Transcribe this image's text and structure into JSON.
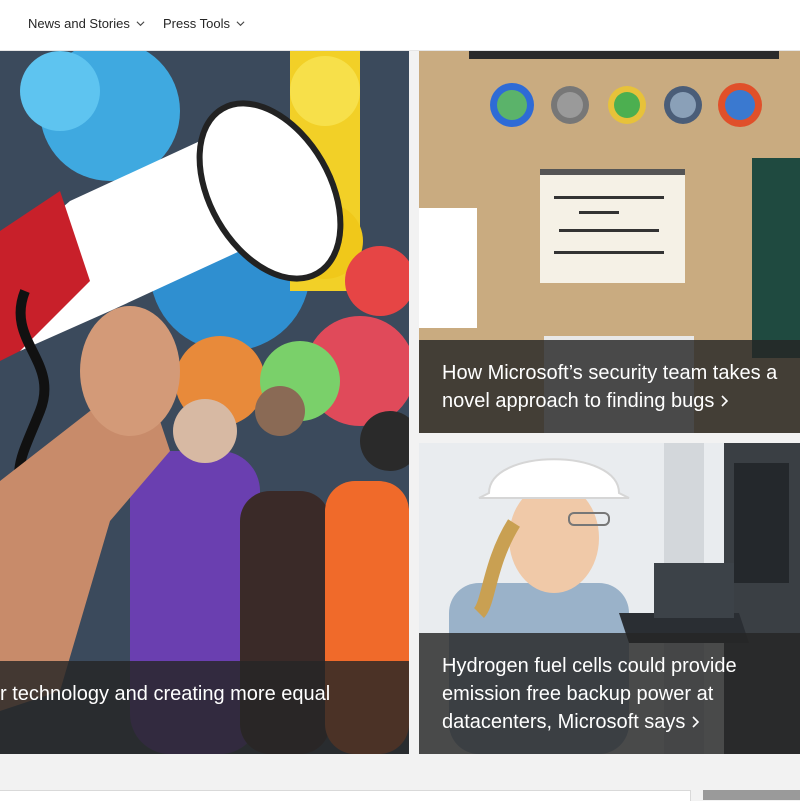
{
  "nav": {
    "items": [
      {
        "label": "News and Stories"
      },
      {
        "label": "Press Tools"
      }
    ]
  },
  "stories": [
    {
      "title": "r technology and creating more equal",
      "image": "megaphone-crowd-photo"
    },
    {
      "title": "How Microsoft’s security team takes a novel approach to finding bugs",
      "image": "security-badges-notepad-photo"
    },
    {
      "title": "Hydrogen fuel cells could provide emission free backup power at datacenters, Microsoft says",
      "image": "engineer-hardhat-laptop-photo"
    }
  ],
  "colors": {
    "overlay": "#262626",
    "nav_bg": "#ffffff",
    "page_bg": "#f2f2f2"
  }
}
